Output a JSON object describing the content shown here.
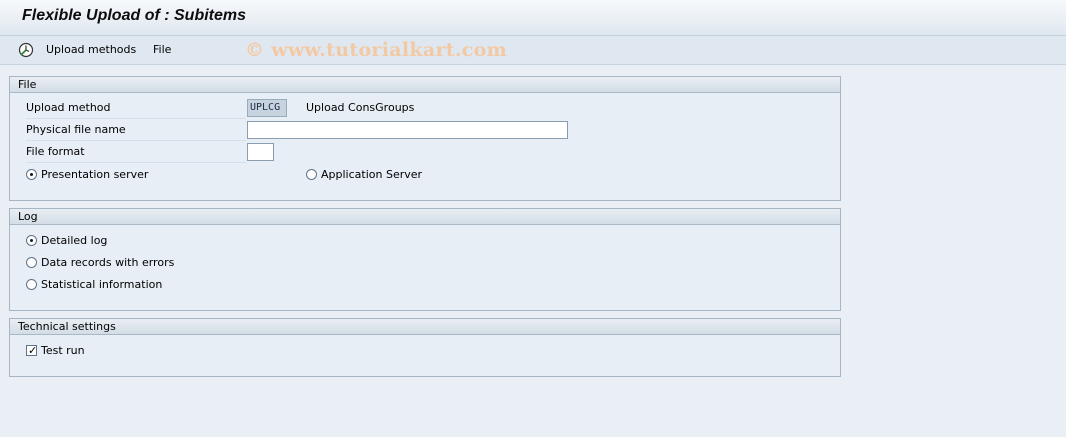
{
  "title": "Flexible Upload of : Subitems",
  "toolbar": {
    "items": [
      "Upload methods",
      "File"
    ],
    "execute_icon": "clock-execute-icon"
  },
  "watermark": "© www.tutorialkart.com",
  "file_group": {
    "title": "File",
    "upload_method": {
      "label": "Upload method",
      "value": "UPLCG",
      "description": "Upload ConsGroups"
    },
    "physical_file_name": {
      "label": "Physical file name",
      "value": ""
    },
    "file_format": {
      "label": "File format",
      "value": ""
    },
    "server_options": [
      {
        "label": "Presentation server",
        "selected": true
      },
      {
        "label": "Application Server",
        "selected": false
      }
    ]
  },
  "log_group": {
    "title": "Log",
    "options": [
      {
        "label": "Detailed log",
        "selected": true
      },
      {
        "label": "Data records with errors",
        "selected": false
      },
      {
        "label": "Statistical information",
        "selected": false
      }
    ]
  },
  "technical_group": {
    "title": "Technical settings",
    "test_run": {
      "label": "Test run",
      "checked": true
    }
  }
}
